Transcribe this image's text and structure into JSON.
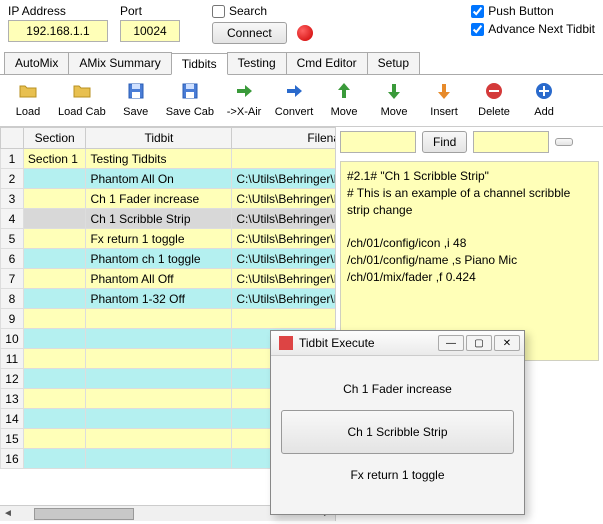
{
  "top": {
    "ip_label": "IP Address",
    "ip_value": "192.168.1.1",
    "port_label": "Port",
    "port_value": "10024",
    "search_label": "Search",
    "connect_label": "Connect",
    "pushbutton_label": "Push Button",
    "advance_label": "Advance Next Tidbit"
  },
  "tabs": [
    "AutoMix",
    "AMix Summary",
    "Tidbits",
    "Testing",
    "Cmd Editor",
    "Setup"
  ],
  "active_tab": "Tidbits",
  "toolbar": [
    {
      "id": "load",
      "label": "Load",
      "icon": "folder"
    },
    {
      "id": "load-cab",
      "label": "Load Cab",
      "icon": "folder"
    },
    {
      "id": "save",
      "label": "Save",
      "icon": "disk"
    },
    {
      "id": "save-cab",
      "label": "Save Cab",
      "icon": "disk"
    },
    {
      "id": "to-xair",
      "label": "->X-Air",
      "icon": "arrow-right-green"
    },
    {
      "id": "convert",
      "label": "Convert",
      "icon": "arrow-right-blue"
    },
    {
      "id": "move-up",
      "label": "Move",
      "icon": "arrow-up-green"
    },
    {
      "id": "move-down",
      "label": "Move",
      "icon": "arrow-down-green"
    },
    {
      "id": "insert",
      "label": "Insert",
      "icon": "arrow-down-orange"
    },
    {
      "id": "delete",
      "label": "Delete",
      "icon": "minus-red"
    },
    {
      "id": "add",
      "label": "Add",
      "icon": "plus-blue"
    }
  ],
  "grid": {
    "headers": [
      "",
      "Section",
      "Tidbit",
      "Filenar"
    ],
    "rows": [
      {
        "n": "1",
        "section": "Section 1",
        "tidbit": "Testing Tidbits",
        "file": "",
        "cls": "y"
      },
      {
        "n": "2",
        "section": "",
        "tidbit": "Phantom All On",
        "file": "C:\\Utils\\Behringer\\F",
        "cls": "c"
      },
      {
        "n": "3",
        "section": "",
        "tidbit": "Ch 1 Fader increase",
        "file": "C:\\Utils\\Behringer\\F",
        "cls": "y"
      },
      {
        "n": "4",
        "section": "",
        "tidbit": "Ch 1 Scribble Strip",
        "file": "C:\\Utils\\Behringer\\F",
        "cls": "c selected"
      },
      {
        "n": "5",
        "section": "",
        "tidbit": "Fx return 1 toggle",
        "file": "C:\\Utils\\Behringer\\F",
        "cls": "y"
      },
      {
        "n": "6",
        "section": "",
        "tidbit": "Phantom ch 1 toggle",
        "file": "C:\\Utils\\Behringer\\F",
        "cls": "c"
      },
      {
        "n": "7",
        "section": "",
        "tidbit": "Phantom All Off",
        "file": "C:\\Utils\\Behringer\\F",
        "cls": "y"
      },
      {
        "n": "8",
        "section": "",
        "tidbit": "Phantom 1-32 Off",
        "file": "C:\\Utils\\Behringer\\F",
        "cls": "c"
      },
      {
        "n": "9",
        "section": "",
        "tidbit": "",
        "file": "",
        "cls": "y"
      },
      {
        "n": "10",
        "section": "",
        "tidbit": "",
        "file": "",
        "cls": "c"
      },
      {
        "n": "11",
        "section": "",
        "tidbit": "",
        "file": "",
        "cls": "y"
      },
      {
        "n": "12",
        "section": "",
        "tidbit": "",
        "file": "",
        "cls": "c"
      },
      {
        "n": "13",
        "section": "",
        "tidbit": "",
        "file": "",
        "cls": "y"
      },
      {
        "n": "14",
        "section": "",
        "tidbit": "",
        "file": "",
        "cls": "c"
      },
      {
        "n": "15",
        "section": "",
        "tidbit": "",
        "file": "",
        "cls": "y"
      },
      {
        "n": "16",
        "section": "",
        "tidbit": "",
        "file": "",
        "cls": "c"
      }
    ]
  },
  "find": {
    "label": "Find"
  },
  "preview_text": "#2.1# \"Ch 1 Scribble Strip\"\n# This is an example of a channel scribble strip change\n\n/ch/01/config/icon ,i 48\n/ch/01/config/name ,s Piano Mic\n/ch/01/mix/fader ,f 0.424",
  "dialog": {
    "title": "Tidbit Execute",
    "prev": "Ch 1 Fader increase",
    "current": "Ch 1 Scribble Strip",
    "next": "Fx return 1 toggle"
  }
}
